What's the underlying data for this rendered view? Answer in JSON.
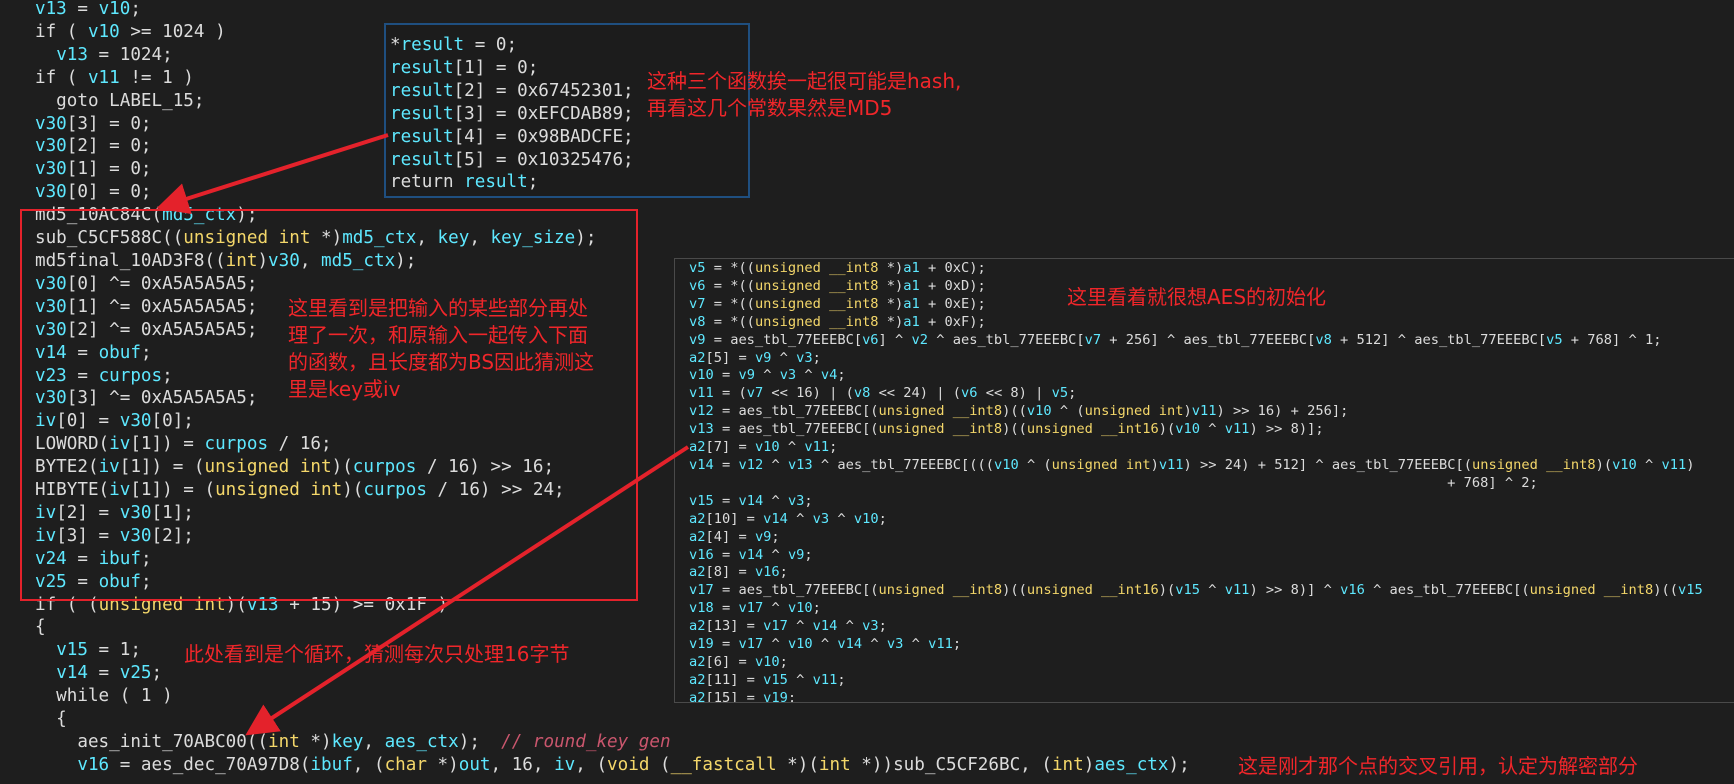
{
  "main_code": {
    "l01": [
      {
        "t": "v13",
        "c": "var"
      },
      {
        "t": " = "
      },
      {
        "t": "v10",
        "c": "var"
      },
      {
        "t": ";"
      }
    ],
    "l02": [
      {
        "t": "if ( "
      },
      {
        "t": "v10",
        "c": "var"
      },
      {
        "t": " >= 1024 )"
      }
    ],
    "l03": [
      {
        "t": "  "
      },
      {
        "t": "v13",
        "c": "var"
      },
      {
        "t": " = 1024;"
      }
    ],
    "l04": [
      {
        "t": "if ( "
      },
      {
        "t": "v11",
        "c": "var"
      },
      {
        "t": " != 1 )"
      }
    ],
    "l05": [
      {
        "t": "  goto LABEL_15;"
      }
    ],
    "l06": [
      {
        "t": "v30",
        "c": "var"
      },
      {
        "t": "[3] = 0;"
      }
    ],
    "l07": [
      {
        "t": "v30",
        "c": "var"
      },
      {
        "t": "[2] = 0;"
      }
    ],
    "l08": [
      {
        "t": "v30",
        "c": "var"
      },
      {
        "t": "[1] = 0;"
      }
    ],
    "l09": [
      {
        "t": "v30",
        "c": "var"
      },
      {
        "t": "[0] = 0;"
      }
    ],
    "l10": [
      {
        "t": "md5_10AC84C("
      },
      {
        "t": "md5_ctx",
        "c": "var"
      },
      {
        "t": ");"
      }
    ],
    "l11": [
      {
        "t": "sub_C5CF588C(("
      },
      {
        "t": "unsigned int",
        "c": "kw"
      },
      {
        "t": " *)"
      },
      {
        "t": "md5_ctx",
        "c": "var"
      },
      {
        "t": ", "
      },
      {
        "t": "key",
        "c": "var"
      },
      {
        "t": ", "
      },
      {
        "t": "key_size",
        "c": "var"
      },
      {
        "t": ");"
      }
    ],
    "l12": [
      {
        "t": "md5final_10AD3F8(("
      },
      {
        "t": "int",
        "c": "kw"
      },
      {
        "t": ")"
      },
      {
        "t": "v30",
        "c": "var"
      },
      {
        "t": ", "
      },
      {
        "t": "md5_ctx",
        "c": "var"
      },
      {
        "t": ");"
      }
    ],
    "l13": [
      {
        "t": "v30",
        "c": "var"
      },
      {
        "t": "[0] ^= 0xA5A5A5A5;"
      }
    ],
    "l14": [
      {
        "t": "v30",
        "c": "var"
      },
      {
        "t": "[1] ^= 0xA5A5A5A5;"
      }
    ],
    "l15": [
      {
        "t": "v30",
        "c": "var"
      },
      {
        "t": "[2] ^= 0xA5A5A5A5;"
      }
    ],
    "l16": [
      {
        "t": "v14",
        "c": "var"
      },
      {
        "t": " = "
      },
      {
        "t": "obuf",
        "c": "var"
      },
      {
        "t": ";"
      }
    ],
    "l17": [
      {
        "t": "v23",
        "c": "var"
      },
      {
        "t": " = "
      },
      {
        "t": "curpos",
        "c": "var"
      },
      {
        "t": ";"
      }
    ],
    "l18": [
      {
        "t": "v30",
        "c": "var"
      },
      {
        "t": "[3] ^= 0xA5A5A5A5;"
      }
    ],
    "l19": [
      {
        "t": "iv",
        "c": "var"
      },
      {
        "t": "[0] = "
      },
      {
        "t": "v30",
        "c": "var"
      },
      {
        "t": "[0];"
      }
    ],
    "l20": [
      {
        "t": "LOWORD("
      },
      {
        "t": "iv",
        "c": "var"
      },
      {
        "t": "[1]) = "
      },
      {
        "t": "curpos",
        "c": "var"
      },
      {
        "t": " / 16;"
      }
    ],
    "l21": [
      {
        "t": "BYTE2("
      },
      {
        "t": "iv",
        "c": "var"
      },
      {
        "t": "[1]) = ("
      },
      {
        "t": "unsigned int",
        "c": "kw"
      },
      {
        "t": ")("
      },
      {
        "t": "curpos",
        "c": "var"
      },
      {
        "t": " / 16) >> 16;"
      }
    ],
    "l22": [
      {
        "t": "HIBYTE("
      },
      {
        "t": "iv",
        "c": "var"
      },
      {
        "t": "[1]) = ("
      },
      {
        "t": "unsigned int",
        "c": "kw"
      },
      {
        "t": ")("
      },
      {
        "t": "curpos",
        "c": "var"
      },
      {
        "t": " / 16) >> 24;"
      }
    ],
    "l23": [
      {
        "t": "iv",
        "c": "var"
      },
      {
        "t": "[2] = "
      },
      {
        "t": "v30",
        "c": "var"
      },
      {
        "t": "[1];"
      }
    ],
    "l24": [
      {
        "t": "iv",
        "c": "var"
      },
      {
        "t": "[3] = "
      },
      {
        "t": "v30",
        "c": "var"
      },
      {
        "t": "[2];"
      }
    ],
    "l25": [
      {
        "t": "v24",
        "c": "var"
      },
      {
        "t": " = "
      },
      {
        "t": "ibuf",
        "c": "var"
      },
      {
        "t": ";"
      }
    ],
    "l26": [
      {
        "t": "v25",
        "c": "var"
      },
      {
        "t": " = "
      },
      {
        "t": "obuf",
        "c": "var"
      },
      {
        "t": ";"
      }
    ],
    "l27": [
      {
        "t": "if ( ("
      },
      {
        "t": "unsigned int",
        "c": "kw"
      },
      {
        "t": ")("
      },
      {
        "t": "v13",
        "c": "var"
      },
      {
        "t": " + 15) >= 0x1F )"
      }
    ],
    "l28": [
      {
        "t": "{"
      }
    ],
    "l29": [
      {
        "t": "  "
      },
      {
        "t": "v15",
        "c": "var"
      },
      {
        "t": " = 1;"
      }
    ],
    "l30": [
      {
        "t": "  "
      },
      {
        "t": "v14",
        "c": "var"
      },
      {
        "t": " = "
      },
      {
        "t": "v25",
        "c": "var"
      },
      {
        "t": ";"
      }
    ],
    "l31": [
      {
        "t": "  while ( 1 )"
      }
    ],
    "l32": [
      {
        "t": "  {"
      }
    ],
    "l33": [
      {
        "t": "    aes_init_70ABC00(("
      },
      {
        "t": "int",
        "c": "kw"
      },
      {
        "t": " *)"
      },
      {
        "t": "key",
        "c": "var"
      },
      {
        "t": ", "
      },
      {
        "t": "aes_ctx",
        "c": "var"
      },
      {
        "t": ");  "
      },
      {
        "t": "// round_key gen",
        "c": "cm"
      }
    ],
    "l34": [
      {
        "t": "    "
      },
      {
        "t": "v16",
        "c": "var"
      },
      {
        "t": " = aes_dec_70A97D8("
      },
      {
        "t": "ibuf",
        "c": "var"
      },
      {
        "t": ", ("
      },
      {
        "t": "char",
        "c": "kw"
      },
      {
        "t": " *)"
      },
      {
        "t": "out",
        "c": "var"
      },
      {
        "t": ", 16, "
      },
      {
        "t": "iv",
        "c": "var"
      },
      {
        "t": ", ("
      },
      {
        "t": "void",
        "c": "kw"
      },
      {
        "t": " ("
      },
      {
        "t": "__fastcall",
        "c": "kw"
      },
      {
        "t": " *)("
      },
      {
        "t": "int",
        "c": "kw"
      },
      {
        "t": " *))sub_C5CF26BC, ("
      },
      {
        "t": "int",
        "c": "kw"
      },
      {
        "t": ")"
      },
      {
        "t": "aes_ctx",
        "c": "var"
      },
      {
        "t": ");"
      }
    ]
  },
  "popup_code": {
    "p1": [
      {
        "t": "*"
      },
      {
        "t": "result",
        "c": "var"
      },
      {
        "t": " = 0;"
      }
    ],
    "p2": [
      {
        "t": "result",
        "c": "var"
      },
      {
        "t": "[1] = 0;"
      }
    ],
    "p3": [
      {
        "t": "result",
        "c": "var"
      },
      {
        "t": "[2] = 0x67452301;"
      }
    ],
    "p4": [
      {
        "t": "result",
        "c": "var"
      },
      {
        "t": "[3] = 0xEFCDAB89;"
      }
    ],
    "p5": [
      {
        "t": "result",
        "c": "var"
      },
      {
        "t": "[4] = 0x98BADCFE;"
      }
    ],
    "p6": [
      {
        "t": "result",
        "c": "var"
      },
      {
        "t": "[5] = 0x10325476;"
      }
    ],
    "p7": [
      {
        "t": "return "
      },
      {
        "t": "result",
        "c": "var"
      },
      {
        "t": ";"
      }
    ]
  },
  "aes_code": {
    "a01": [
      {
        "t": "v5",
        "c": "var"
      },
      {
        "t": " = *(("
      },
      {
        "t": "unsigned __int8",
        "c": "kw"
      },
      {
        "t": " *)"
      },
      {
        "t": "a1",
        "c": "var"
      },
      {
        "t": " + 0xC);"
      }
    ],
    "a02": [
      {
        "t": "v6",
        "c": "var"
      },
      {
        "t": " = *(("
      },
      {
        "t": "unsigned __int8",
        "c": "kw"
      },
      {
        "t": " *)"
      },
      {
        "t": "a1",
        "c": "var"
      },
      {
        "t": " + 0xD);"
      }
    ],
    "a03": [
      {
        "t": "v7",
        "c": "var"
      },
      {
        "t": " = *(("
      },
      {
        "t": "unsigned __int8",
        "c": "kw"
      },
      {
        "t": " *)"
      },
      {
        "t": "a1",
        "c": "var"
      },
      {
        "t": " + 0xE);"
      }
    ],
    "a04": [
      {
        "t": "v8",
        "c": "var"
      },
      {
        "t": " = *(("
      },
      {
        "t": "unsigned __int8",
        "c": "kw"
      },
      {
        "t": " *)"
      },
      {
        "t": "a1",
        "c": "var"
      },
      {
        "t": " + 0xF);"
      }
    ],
    "a05": [
      {
        "t": "v9",
        "c": "var"
      },
      {
        "t": " = aes_tbl_77EEEBC["
      },
      {
        "t": "v6",
        "c": "var"
      },
      {
        "t": "] ^ "
      },
      {
        "t": "v2",
        "c": "var"
      },
      {
        "t": " ^ aes_tbl_77EEEBC["
      },
      {
        "t": "v7",
        "c": "var"
      },
      {
        "t": " + 256] ^ aes_tbl_77EEEBC["
      },
      {
        "t": "v8",
        "c": "var"
      },
      {
        "t": " + 512] ^ aes_tbl_77EEEBC["
      },
      {
        "t": "v5",
        "c": "var"
      },
      {
        "t": " + 768] ^ 1;"
      }
    ],
    "a06": [
      {
        "t": "a2",
        "c": "var"
      },
      {
        "t": "[5] = "
      },
      {
        "t": "v9",
        "c": "var"
      },
      {
        "t": " ^ "
      },
      {
        "t": "v3",
        "c": "var"
      },
      {
        "t": ";"
      }
    ],
    "a07": [
      {
        "t": "v10",
        "c": "var"
      },
      {
        "t": " = "
      },
      {
        "t": "v9",
        "c": "var"
      },
      {
        "t": " ^ "
      },
      {
        "t": "v3",
        "c": "var"
      },
      {
        "t": " ^ "
      },
      {
        "t": "v4",
        "c": "var"
      },
      {
        "t": ";"
      }
    ],
    "a08": [
      {
        "t": "v11",
        "c": "var"
      },
      {
        "t": " = ("
      },
      {
        "t": "v7",
        "c": "var"
      },
      {
        "t": " << 16) | ("
      },
      {
        "t": "v8",
        "c": "var"
      },
      {
        "t": " << 24) | ("
      },
      {
        "t": "v6",
        "c": "var"
      },
      {
        "t": " << 8) | "
      },
      {
        "t": "v5",
        "c": "var"
      },
      {
        "t": ";"
      }
    ],
    "a09": [
      {
        "t": "v12",
        "c": "var"
      },
      {
        "t": " = aes_tbl_77EEEBC[("
      },
      {
        "t": "unsigned __int8",
        "c": "kw"
      },
      {
        "t": ")(("
      },
      {
        "t": "v10",
        "c": "var"
      },
      {
        "t": " ^ ("
      },
      {
        "t": "unsigned int",
        "c": "kw"
      },
      {
        "t": ")"
      },
      {
        "t": "v11",
        "c": "var"
      },
      {
        "t": ") >> 16) + 256];"
      }
    ],
    "a10": [
      {
        "t": "v13",
        "c": "var"
      },
      {
        "t": " = aes_tbl_77EEEBC[("
      },
      {
        "t": "unsigned __int8",
        "c": "kw"
      },
      {
        "t": ")(("
      },
      {
        "t": "unsigned __int16",
        "c": "kw"
      },
      {
        "t": ")("
      },
      {
        "t": "v10",
        "c": "var"
      },
      {
        "t": " ^ "
      },
      {
        "t": "v11",
        "c": "var"
      },
      {
        "t": ") >> 8)];"
      }
    ],
    "a11": [
      {
        "t": "a2",
        "c": "var"
      },
      {
        "t": "[7] = "
      },
      {
        "t": "v10",
        "c": "var"
      },
      {
        "t": " ^ "
      },
      {
        "t": "v11",
        "c": "var"
      },
      {
        "t": ";"
      }
    ],
    "a12": [
      {
        "t": "v14",
        "c": "var"
      },
      {
        "t": " = "
      },
      {
        "t": "v12",
        "c": "var"
      },
      {
        "t": " ^ "
      },
      {
        "t": "v13",
        "c": "var"
      },
      {
        "t": " ^ aes_tbl_77EEEBC[((("
      },
      {
        "t": "v10",
        "c": "var"
      },
      {
        "t": " ^ ("
      },
      {
        "t": "unsigned int",
        "c": "kw"
      },
      {
        "t": ")"
      },
      {
        "t": "v11",
        "c": "var"
      },
      {
        "t": ") >> 24) + 512] ^ aes_tbl_77EEEBC[("
      },
      {
        "t": "unsigned __int8",
        "c": "kw"
      },
      {
        "t": ")("
      },
      {
        "t": "v10",
        "c": "var"
      },
      {
        "t": " ^ "
      },
      {
        "t": "v11",
        "c": "var"
      },
      {
        "t": ")"
      }
    ],
    "a13": [
      {
        "t": "                                                                                            + 768] ^ 2;"
      }
    ],
    "a14": [
      {
        "t": "v15",
        "c": "var"
      },
      {
        "t": " = "
      },
      {
        "t": "v14",
        "c": "var"
      },
      {
        "t": " ^ "
      },
      {
        "t": "v3",
        "c": "var"
      },
      {
        "t": ";"
      }
    ],
    "a15": [
      {
        "t": "a2",
        "c": "var"
      },
      {
        "t": "[10] = "
      },
      {
        "t": "v14",
        "c": "var"
      },
      {
        "t": " ^ "
      },
      {
        "t": "v3",
        "c": "var"
      },
      {
        "t": " ^ "
      },
      {
        "t": "v10",
        "c": "var"
      },
      {
        "t": ";"
      }
    ],
    "a16": [
      {
        "t": "a2",
        "c": "var"
      },
      {
        "t": "[4] = "
      },
      {
        "t": "v9",
        "c": "var"
      },
      {
        "t": ";"
      }
    ],
    "a17": [
      {
        "t": "v16",
        "c": "var"
      },
      {
        "t": " = "
      },
      {
        "t": "v14",
        "c": "var"
      },
      {
        "t": " ^ "
      },
      {
        "t": "v9",
        "c": "var"
      },
      {
        "t": ";"
      }
    ],
    "a18": [
      {
        "t": "a2",
        "c": "var"
      },
      {
        "t": "[8] = "
      },
      {
        "t": "v16",
        "c": "var"
      },
      {
        "t": ";"
      }
    ],
    "a19": [
      {
        "t": "v17",
        "c": "var"
      },
      {
        "t": " = aes_tbl_77EEEBC[("
      },
      {
        "t": "unsigned __int8",
        "c": "kw"
      },
      {
        "t": ")(("
      },
      {
        "t": "unsigned __int16",
        "c": "kw"
      },
      {
        "t": ")("
      },
      {
        "t": "v15",
        "c": "var"
      },
      {
        "t": " ^ "
      },
      {
        "t": "v11",
        "c": "var"
      },
      {
        "t": ") >> 8)] ^ "
      },
      {
        "t": "v16",
        "c": "var"
      },
      {
        "t": " ^ aes_tbl_77EEEBC[("
      },
      {
        "t": "unsigned __int8",
        "c": "kw"
      },
      {
        "t": ")(("
      },
      {
        "t": "v15",
        "c": "var"
      }
    ],
    "a20": [
      {
        "t": "v18",
        "c": "var"
      },
      {
        "t": " = "
      },
      {
        "t": "v17",
        "c": "var"
      },
      {
        "t": " ^ "
      },
      {
        "t": "v10",
        "c": "var"
      },
      {
        "t": ";"
      }
    ],
    "a21": [
      {
        "t": "a2",
        "c": "var"
      },
      {
        "t": "[13] = "
      },
      {
        "t": "v17",
        "c": "var"
      },
      {
        "t": " ^ "
      },
      {
        "t": "v14",
        "c": "var"
      },
      {
        "t": " ^ "
      },
      {
        "t": "v3",
        "c": "var"
      },
      {
        "t": ";"
      }
    ],
    "a22": [
      {
        "t": "v19",
        "c": "var"
      },
      {
        "t": " = "
      },
      {
        "t": "v17",
        "c": "var"
      },
      {
        "t": " ^ "
      },
      {
        "t": "v10",
        "c": "var"
      },
      {
        "t": " ^ "
      },
      {
        "t": "v14",
        "c": "var"
      },
      {
        "t": " ^ "
      },
      {
        "t": "v3",
        "c": "var"
      },
      {
        "t": " ^ "
      },
      {
        "t": "v11",
        "c": "var"
      },
      {
        "t": ";"
      }
    ],
    "a23": [
      {
        "t": "a2",
        "c": "var"
      },
      {
        "t": "[6] = "
      },
      {
        "t": "v10",
        "c": "var"
      },
      {
        "t": ";"
      }
    ],
    "a24": [
      {
        "t": "a2",
        "c": "var"
      },
      {
        "t": "[11] = "
      },
      {
        "t": "v15",
        "c": "var"
      },
      {
        "t": " ^ "
      },
      {
        "t": "v11",
        "c": "var"
      },
      {
        "t": ";"
      }
    ],
    "a25": [
      {
        "t": "a2",
        "c": "var"
      },
      {
        "t": "[15] = "
      },
      {
        "t": "v19",
        "c": "var"
      },
      {
        "t": ";"
      }
    ]
  },
  "notes": {
    "md5": "这种三个函数挨一起很可能是hash,\n再看这几个常数果然是MD5",
    "key_iv": "这里看到是把输入的某些部分再处\n理了一次，和原输入一起传入下面\n的函数，且长度都为BS因此猜测这\n里是key或iv",
    "aes_init": "这里看着就很想AES的初始化",
    "loop": "此处看到是个循环，猜测每次只处理16字节",
    "decrypt": "这是刚才那个点的交叉引用，认定为解密部分"
  },
  "colors": {
    "background": "#1e1e1e",
    "text": "#dcdcdc",
    "variable": "#5ee8ff",
    "keyword": "#f4d76a",
    "comment": "#c9566d",
    "annotation_red": "#e4222b",
    "popup_border": "#1f4f80"
  }
}
